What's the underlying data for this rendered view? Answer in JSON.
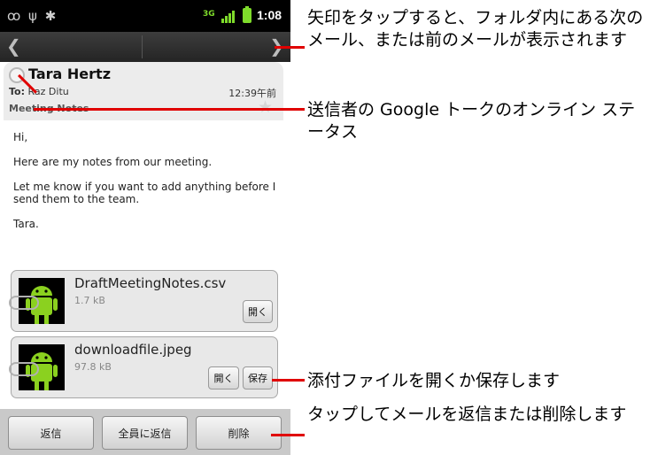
{
  "status_bar": {
    "time": "1:08",
    "network": "3G",
    "icons": [
      "voicemail-icon",
      "usb-icon",
      "android-debug-icon",
      "signal-icon",
      "battery-icon"
    ]
  },
  "nav": {
    "prev_icon": "chevron-left-icon",
    "next_icon": "chevron-right-icon"
  },
  "header": {
    "sender": "Tara Hertz",
    "to_label": "To:",
    "to_value": "Raz Ditu",
    "time": "12:39午前",
    "subject": "Meeting Notes"
  },
  "body": {
    "paragraphs": [
      "Hi,",
      "Here are my notes from our meeting.",
      "Let me know if you want to add anything before I send them to the team.",
      "Tara."
    ]
  },
  "attachments": [
    {
      "name": "DraftMeetingNotes.csv",
      "size": "1.7 kB",
      "open_label": "開く"
    },
    {
      "name": "downloadfile.jpeg",
      "size": "97.8 kB",
      "open_label": "開く",
      "save_label": "保存"
    }
  ],
  "actions": {
    "reply": "返信",
    "reply_all": "全員に返信",
    "delete": "削除"
  },
  "callouts": {
    "arrows": "矢印をタップすると、フォルダ内にある次のメール、または前のメールが表示されます",
    "presence": "送信者の Google トークのオンライン ステータス",
    "attachments": "添付ファイルを開くか保存します",
    "reply_delete": "タップしてメールを返信または削除します"
  },
  "colors": {
    "callout_line": "#e00000",
    "signal_accent": "#7fdc2b",
    "status_bar": "#000000"
  }
}
